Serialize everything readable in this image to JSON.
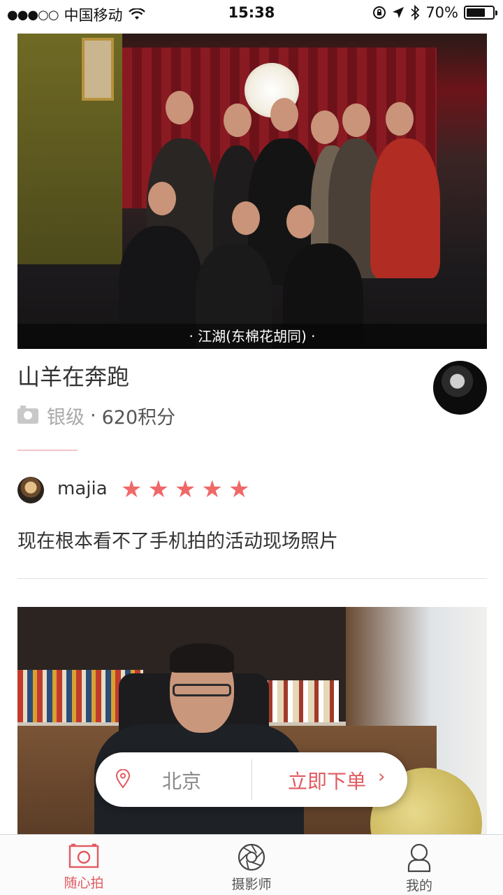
{
  "status_bar": {
    "carrier": "中国移动",
    "time": "15:38",
    "battery": "70%",
    "battery_level": 0.7
  },
  "cards": [
    {
      "photo_caption": "· 江湖(东棉花胡同) ·",
      "author": {
        "name": "山羊在奔跑",
        "level": "银级",
        "separator": "·",
        "points": "620积分"
      },
      "review": {
        "user": "majia",
        "rating": 5,
        "stars": [
          "★",
          "★",
          "★",
          "★",
          "★"
        ],
        "text": "现在根本看不了手机拍的活动现场照片"
      }
    }
  ],
  "order_bar": {
    "city": "北京",
    "order_label": "立即下单",
    "chevron": "›"
  },
  "tabs": [
    {
      "label": "随心拍",
      "icon": "camera-frame-icon",
      "active": true
    },
    {
      "label": "摄影师",
      "icon": "aperture-icon",
      "active": false
    },
    {
      "label": "我的",
      "icon": "user-icon",
      "active": false
    }
  ],
  "colors": {
    "accent": "#e05a60",
    "star": "#f06868",
    "level_gray": "#a9a9a9"
  }
}
